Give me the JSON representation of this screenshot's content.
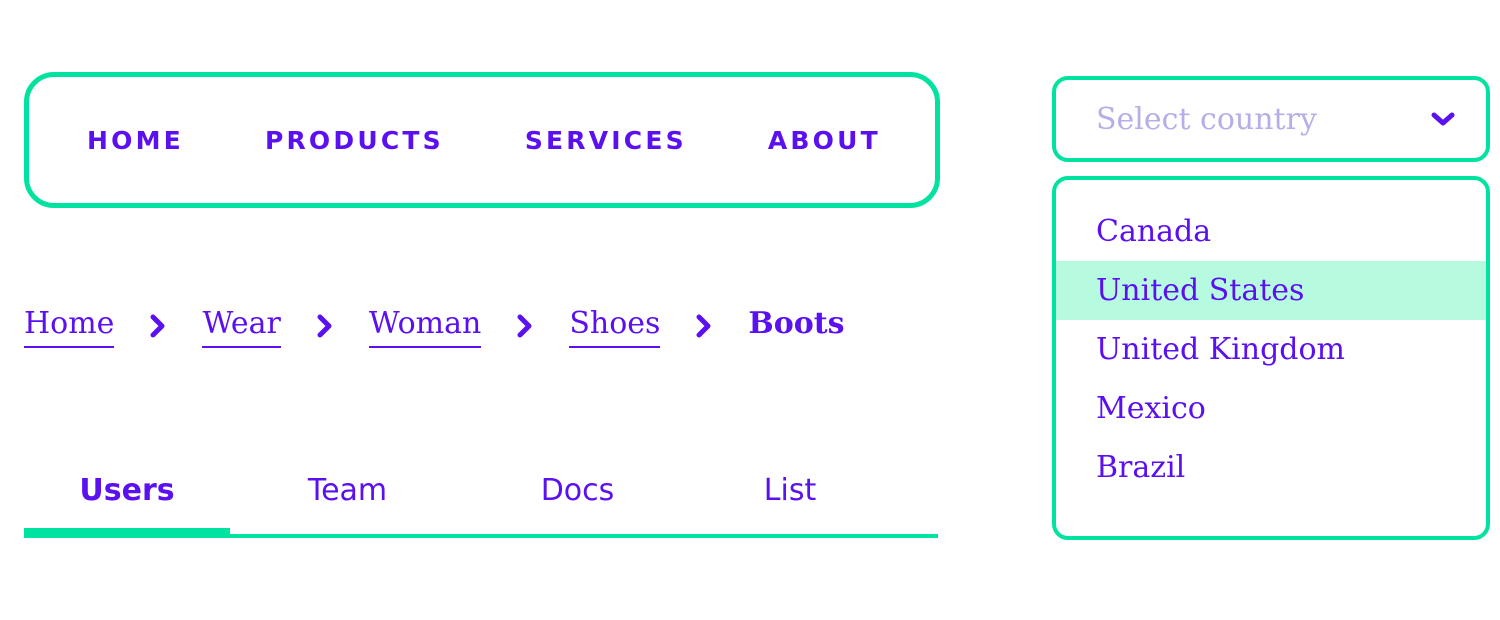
{
  "theme": {
    "accent_green": "#00e3a0",
    "accent_green_soft": "#b6fbe0",
    "text_purple": "#5b10f0",
    "placeholder_purple": "#b5aee8",
    "background": "#ffffff"
  },
  "navbar": {
    "items": [
      {
        "label": "HOME"
      },
      {
        "label": "PRODUCTS"
      },
      {
        "label": "SERVICES"
      },
      {
        "label": "ABOUT"
      }
    ]
  },
  "breadcrumb": {
    "separator_icon": "chevron-right-icon",
    "items": [
      {
        "label": "Home",
        "current": false
      },
      {
        "label": "Wear",
        "current": false
      },
      {
        "label": "Woman",
        "current": false
      },
      {
        "label": "Shoes",
        "current": false
      },
      {
        "label": "Boots",
        "current": true
      }
    ]
  },
  "tabs": {
    "items": [
      {
        "label": "Users",
        "active": true
      },
      {
        "label": "Team",
        "active": false
      },
      {
        "label": "Docs",
        "active": false
      },
      {
        "label": "List",
        "active": false
      }
    ]
  },
  "select": {
    "placeholder": "Select country",
    "value": "Select country",
    "chevron_icon": "chevron-down-icon",
    "expanded": true,
    "options": [
      {
        "label": "Canada",
        "selected": false
      },
      {
        "label": "United States",
        "selected": true
      },
      {
        "label": "United Kingdom",
        "selected": false
      },
      {
        "label": "Mexico",
        "selected": false
      },
      {
        "label": "Brazil",
        "selected": false
      }
    ]
  }
}
